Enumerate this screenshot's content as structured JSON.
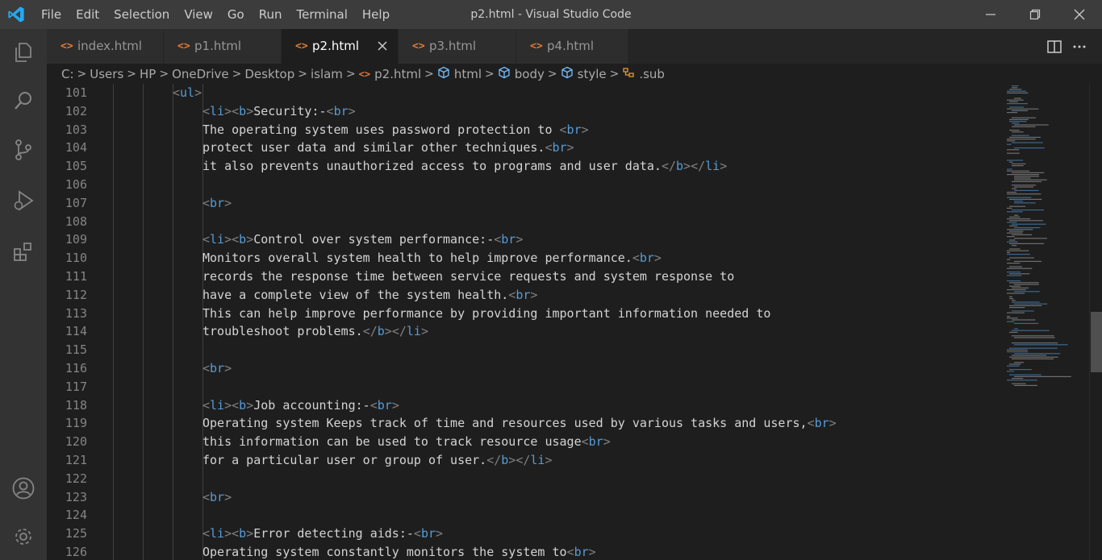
{
  "window": {
    "title": "p2.html - Visual Studio Code",
    "menu": [
      "File",
      "Edit",
      "Selection",
      "View",
      "Go",
      "Run",
      "Terminal",
      "Help"
    ],
    "controls": [
      "minimize-icon",
      "restore-icon",
      "close-icon"
    ]
  },
  "activity_bar": {
    "top": [
      "explorer-icon",
      "search-icon",
      "source-control-icon",
      "run-debug-icon",
      "extensions-icon"
    ],
    "bottom": [
      "accounts-icon",
      "settings-gear-icon"
    ]
  },
  "tabs": [
    {
      "label": "index.html",
      "active": false
    },
    {
      "label": "p1.html",
      "active": false
    },
    {
      "label": "p2.html",
      "active": true
    },
    {
      "label": "p3.html",
      "active": false
    },
    {
      "label": "p4.html",
      "active": false
    }
  ],
  "tab_icon_glyph": "<>",
  "breadcrumb": {
    "items": [
      "C:",
      "Users",
      "HP",
      "OneDrive",
      "Desktop",
      "islam",
      "p2.html",
      "html",
      "body",
      "style",
      ".sub"
    ],
    "separator": ">"
  },
  "editor": {
    "lines": [
      {
        "num": "101",
        "indent": 3,
        "text": "<ul>"
      },
      {
        "num": "102",
        "indent": 4,
        "text": "<li><b>Security:-<br>"
      },
      {
        "num": "103",
        "indent": 4,
        "text": "The operating system uses password protection to <br>"
      },
      {
        "num": "104",
        "indent": 4,
        "text": "protect user data and similar other techniques.<br>"
      },
      {
        "num": "105",
        "indent": 4,
        "text": "it also prevents unauthorized access to programs and user data.</b></li>"
      },
      {
        "num": "106",
        "indent": 4,
        "text": ""
      },
      {
        "num": "107",
        "indent": 4,
        "text": "<br>"
      },
      {
        "num": "108",
        "indent": 4,
        "text": ""
      },
      {
        "num": "109",
        "indent": 4,
        "text": "<li><b>Control over system performance:-<br>"
      },
      {
        "num": "110",
        "indent": 4,
        "text": "Monitors overall system health to help improve performance.<br>"
      },
      {
        "num": "111",
        "indent": 4,
        "text": "records the response time between service requests and system response to"
      },
      {
        "num": "112",
        "indent": 4,
        "text": "have a complete view of the system health.<br>"
      },
      {
        "num": "113",
        "indent": 4,
        "text": "This can help improve performance by providing important information needed to"
      },
      {
        "num": "114",
        "indent": 4,
        "text": "troubleshoot problems.</b></li>"
      },
      {
        "num": "115",
        "indent": 4,
        "text": ""
      },
      {
        "num": "116",
        "indent": 4,
        "text": "<br>"
      },
      {
        "num": "117",
        "indent": 4,
        "text": ""
      },
      {
        "num": "118",
        "indent": 4,
        "text": "<li><b>Job accounting:-<br>"
      },
      {
        "num": "119",
        "indent": 4,
        "text": "Operating system Keeps track of time and resources used by various tasks and users,<br>"
      },
      {
        "num": "120",
        "indent": 4,
        "text": "this information can be used to track resource usage<br>"
      },
      {
        "num": "121",
        "indent": 4,
        "text": "for a particular user or group of user.</b></li>"
      },
      {
        "num": "122",
        "indent": 4,
        "text": ""
      },
      {
        "num": "123",
        "indent": 4,
        "text": "<br>"
      },
      {
        "num": "124",
        "indent": 4,
        "text": ""
      },
      {
        "num": "125",
        "indent": 4,
        "text": "<li><b>Error detecting aids:-<br>"
      },
      {
        "num": "126",
        "indent": 4,
        "text": "Operating system constantly monitors the system to<br>"
      }
    ]
  },
  "colors": {
    "tag": "#569cd6",
    "punctuation": "#808080",
    "text": "#d4d4d4",
    "line_number": "#858585",
    "html_tab_icon": "#e37933",
    "vscode_blue": "#23a9f2"
  }
}
